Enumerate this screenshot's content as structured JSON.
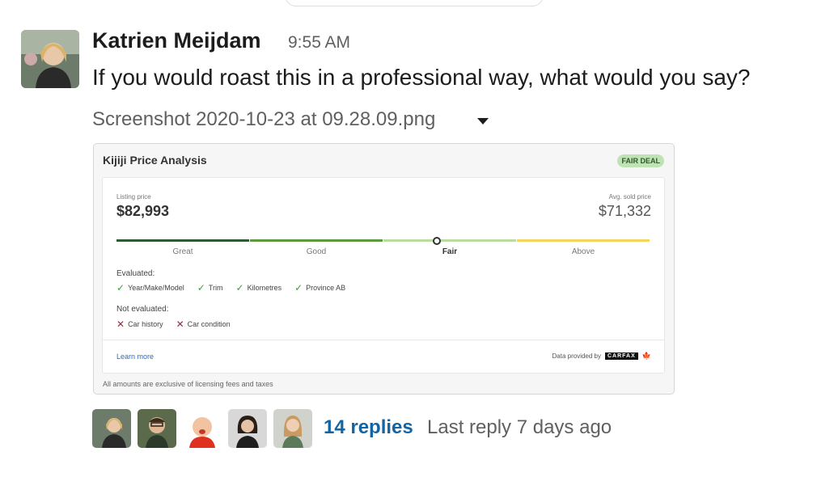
{
  "message": {
    "author": "Katrien Meijdam",
    "time": "9:55 AM",
    "text": "If you would roast this in a professional way, what would you say?",
    "attachment_name": "Screenshot 2020-10-23 at 09.28.09.png"
  },
  "card": {
    "title": "Kijiji Price Analysis",
    "badge": "FAIR DEAL",
    "listing_label": "Listing price",
    "listing_price": "$82,993",
    "avg_label": "Avg. sold price",
    "avg_price": "$71,332",
    "scale": [
      {
        "label": "Great",
        "color": "#2e5b32"
      },
      {
        "label": "Good",
        "color": "#5d9a3d"
      },
      {
        "label": "Fair",
        "color": "#b9dc9f"
      },
      {
        "label": "Above",
        "color": "#f2d45f"
      }
    ],
    "evaluated_label": "Evaluated:",
    "evaluated": [
      "Year/Make/Model",
      "Trim",
      "Kilometres",
      "Province AB"
    ],
    "not_evaluated_label": "Not evaluated:",
    "not_evaluated": [
      "Car history",
      "Car condition"
    ],
    "learn_more": "Learn more",
    "data_provided": "Data provided by",
    "provider_logo": "CARFAX",
    "footnote": "All amounts are exclusive of licensing fees and taxes"
  },
  "thread": {
    "replies": "14 replies",
    "last_reply": "Last reply 7 days ago"
  }
}
